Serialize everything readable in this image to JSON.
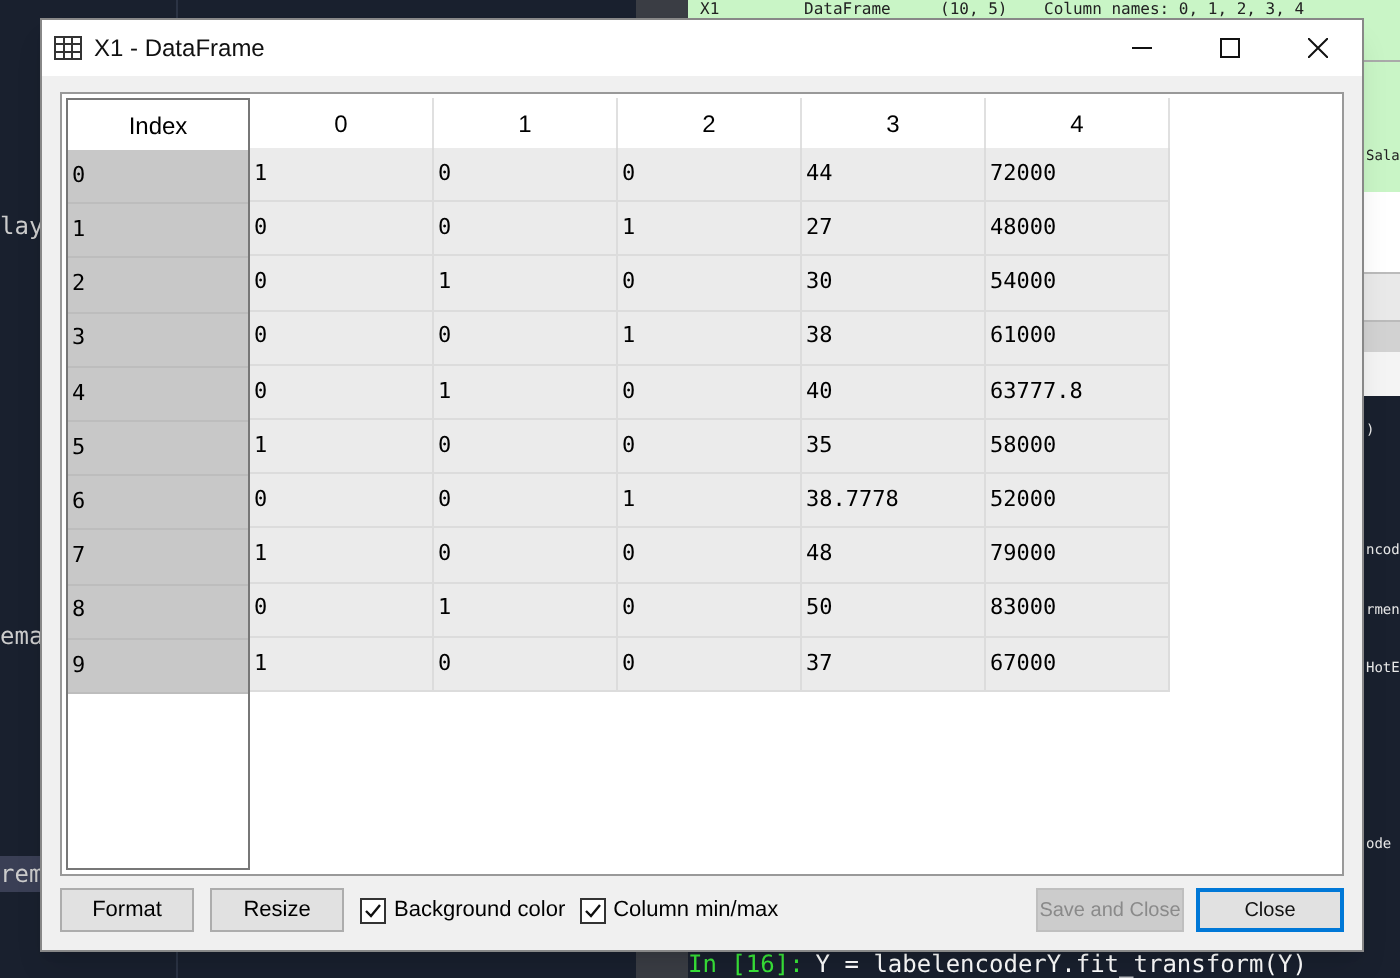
{
  "background": {
    "variable_row": {
      "name": "X1",
      "type": "DataFrame",
      "size": "(10, 5)",
      "value": "Column names: 0, 1, 2, 3, 4"
    },
    "value_fragment": "Sala",
    "editor_left": [
      "lay",
      "ema",
      "rem"
    ],
    "editor_right": [
      ")",
      "ncod",
      "rmen",
      "HotE",
      "ode"
    ],
    "console": {
      "prompt": "In [16]:",
      "code": "Y = labelencoderY.fit_transform(Y)"
    }
  },
  "window": {
    "title": "X1 - DataFrame"
  },
  "table": {
    "index_header": "Index",
    "columns": [
      "0",
      "1",
      "2",
      "3",
      "4"
    ],
    "rows": [
      {
        "index": "0",
        "cells": [
          "1",
          "0",
          "0",
          "44",
          "72000"
        ]
      },
      {
        "index": "1",
        "cells": [
          "0",
          "0",
          "1",
          "27",
          "48000"
        ]
      },
      {
        "index": "2",
        "cells": [
          "0",
          "1",
          "0",
          "30",
          "54000"
        ]
      },
      {
        "index": "3",
        "cells": [
          "0",
          "0",
          "1",
          "38",
          "61000"
        ]
      },
      {
        "index": "4",
        "cells": [
          "0",
          "1",
          "0",
          "40",
          "63777.8"
        ]
      },
      {
        "index": "5",
        "cells": [
          "1",
          "0",
          "0",
          "35",
          "58000"
        ]
      },
      {
        "index": "6",
        "cells": [
          "0",
          "0",
          "1",
          "38.7778",
          "52000"
        ]
      },
      {
        "index": "7",
        "cells": [
          "1",
          "0",
          "0",
          "48",
          "79000"
        ]
      },
      {
        "index": "8",
        "cells": [
          "0",
          "1",
          "0",
          "50",
          "83000"
        ]
      },
      {
        "index": "9",
        "cells": [
          "1",
          "0",
          "0",
          "37",
          "67000"
        ]
      }
    ]
  },
  "footer": {
    "left_buttons": [
      "Format",
      "Resize"
    ],
    "checkboxes": [
      {
        "label": "Background color",
        "checked": true
      },
      {
        "label": "Column min/max",
        "checked": true
      }
    ],
    "right_buttons": [
      {
        "label": "Save and Close",
        "disabled": true,
        "default": false
      },
      {
        "label": "Close",
        "disabled": false,
        "default": true
      }
    ]
  }
}
